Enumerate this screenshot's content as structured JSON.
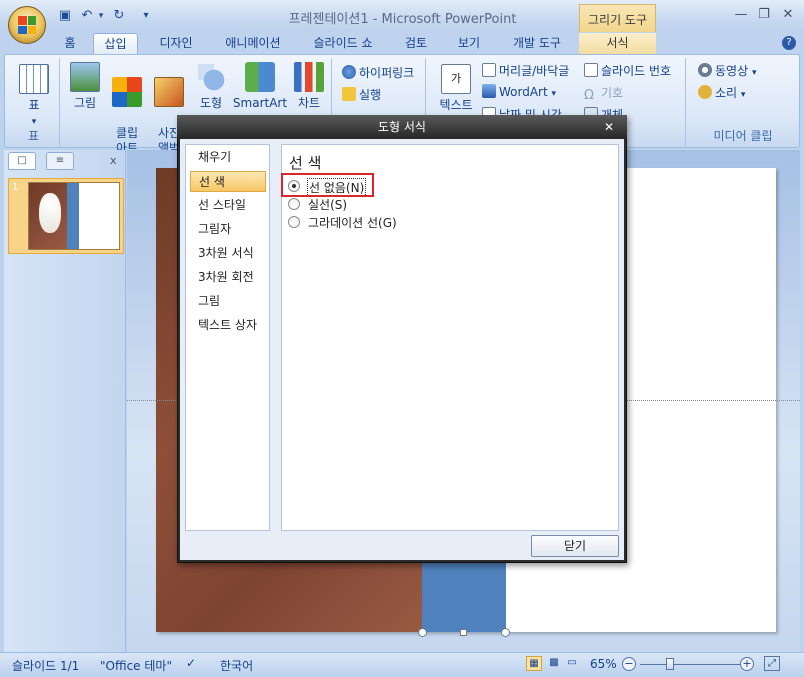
{
  "window": {
    "title": "프레젠테이션1 - Microsoft PowerPoint",
    "contextual_tab_header": "그리기 도구"
  },
  "tabs": [
    "홈",
    "삽입",
    "디자인",
    "애니메이션",
    "슬라이드 쇼",
    "검토",
    "보기",
    "개발 도구",
    "서식"
  ],
  "ribbon": {
    "table_label": "표",
    "table_group": "표",
    "picture": "그림",
    "clipart": "클립\n아트",
    "photo_album": "사진\n앨범",
    "shapes": "도형",
    "smartart": "SmartArt",
    "chart": "차트",
    "illustrations_group": "일러",
    "hyperlink": "하이퍼링크",
    "action": "실행",
    "textbox": "텍스트",
    "header_footer": "머리글/바닥글",
    "wordart": "WordArt",
    "date_time": "날짜 및 시간",
    "slide_number": "슬라이드 번호",
    "symbol": "기호",
    "object": "개체",
    "movie": "동영상",
    "sound": "소리",
    "media_group": "미디어 클립"
  },
  "left_panel": {
    "close": "x",
    "slide_number": "1"
  },
  "dialog": {
    "title": "도형 서식",
    "nav": [
      "채우기",
      "선 색",
      "선 스타일",
      "그림자",
      "3차원 서식",
      "3차원 회전",
      "그림",
      "텍스트 상자"
    ],
    "selected_nav": "선 색",
    "section_title": "선 색",
    "options": [
      {
        "label": "선 없음(N)",
        "checked": true
      },
      {
        "label": "실선(S)",
        "checked": false
      },
      {
        "label": "그라데이션 선(G)",
        "checked": false
      }
    ],
    "close_button": "닫기"
  },
  "status": {
    "slide": "슬라이드 1/1",
    "theme": "\"Office 테마\"",
    "language": "한국어",
    "zoom": "65%"
  },
  "colors": {
    "highlight": "#d62828",
    "shape_fill": "#4f81bd",
    "background_texture": "#8e4f39"
  }
}
